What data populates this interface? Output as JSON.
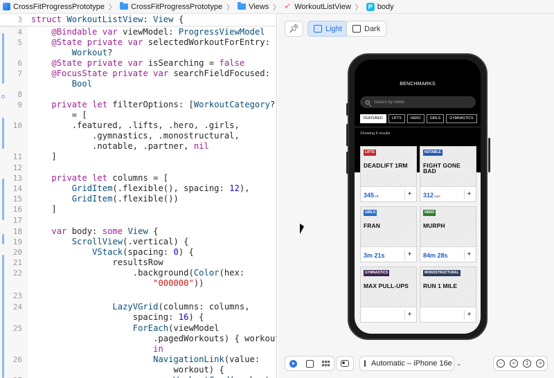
{
  "breadcrumb": [
    {
      "label": "CrossFitProgressPrototype",
      "icon": "app-icon"
    },
    {
      "label": "CrossFitProgressPrototype",
      "icon": "folder-icon"
    },
    {
      "label": "Views",
      "icon": "folder-icon"
    },
    {
      "label": "WorkoutListView",
      "icon": "swift-file-icon"
    },
    {
      "label": "body",
      "icon": "property-icon",
      "badge": "P"
    }
  ],
  "editor": {
    "lines": [
      {
        "n": "3",
        "code": "struct WorkoutListView: View {"
      },
      {
        "n": "4",
        "code": "    @Bindable var viewModel: ProgressViewModel"
      },
      {
        "n": "5",
        "code": "    @State private var selectedWorkoutForEntry:"
      },
      {
        "n": "",
        "code": "        Workout?"
      },
      {
        "n": "6",
        "code": "    @State private var isSearching = false"
      },
      {
        "n": "7",
        "code": "    @FocusState private var searchFieldFocused:"
      },
      {
        "n": "",
        "code": "        Bool"
      },
      {
        "n": "8",
        "code": ""
      },
      {
        "n": "9",
        "code": "    private let filterOptions: [WorkoutCategory?]"
      },
      {
        "n": "",
        "code": "        = ["
      },
      {
        "n": "10",
        "code": "        .featured, .lifts, .hero, .girls,"
      },
      {
        "n": "",
        "code": "            .gymnastics, .monostructural,"
      },
      {
        "n": "",
        "code": "            .notable, .partner, nil"
      },
      {
        "n": "11",
        "code": "    ]"
      },
      {
        "n": "12",
        "code": ""
      },
      {
        "n": "13",
        "code": "    private let columns = ["
      },
      {
        "n": "14",
        "code": "        GridItem(.flexible(), spacing: 12),"
      },
      {
        "n": "15",
        "code": "        GridItem(.flexible())"
      },
      {
        "n": "16",
        "code": "    ]"
      },
      {
        "n": "17",
        "code": ""
      },
      {
        "n": "18",
        "code": "    var body: some View {"
      },
      {
        "n": "19",
        "code": "        ScrollView(.vertical) {"
      },
      {
        "n": "20",
        "code": "            VStack(spacing: 0) {"
      },
      {
        "n": "21",
        "code": "                resultsRow"
      },
      {
        "n": "22",
        "code": "                    .background(Color(hex:"
      },
      {
        "n": "",
        "code": "                        \"000000\"))"
      },
      {
        "n": "23",
        "code": ""
      },
      {
        "n": "24",
        "code": "                LazyVGrid(columns: columns,"
      },
      {
        "n": "",
        "code": "                    spacing: 16) {"
      },
      {
        "n": "25",
        "code": "                    ForEach(viewModel"
      },
      {
        "n": "",
        "code": "                        .pagedWorkouts) { workout"
      },
      {
        "n": "",
        "code": "                        in"
      },
      {
        "n": "26",
        "code": "                        NavigationLink(value:"
      },
      {
        "n": "",
        "code": "                            workout) {"
      },
      {
        "n": "27",
        "code": "                            WorkoutCard(workout:"
      }
    ]
  },
  "canvas": {
    "mode_light": "Light",
    "mode_dark": "Dark",
    "device": "Automatic – iPhone 16e"
  },
  "preview": {
    "title": "BENCHMARKS",
    "search_placeholder": "Search by name",
    "filters": [
      "FEATURED",
      "LIFTS",
      "HERO",
      "GIRLS",
      "GYMNASTICS"
    ],
    "active_filter": "FEATURED",
    "results_text": "Showing 6 results",
    "cards": [
      {
        "tag": "LIFTS",
        "tag_color": "#c0282d",
        "name": "DEADLIFT 1RM",
        "value": "345",
        "unit": "LB"
      },
      {
        "tag": "NOTABLE",
        "tag_color": "#2a57b4",
        "name": "FIGHT GONE BAD",
        "value": "312",
        "unit": "reps"
      },
      {
        "tag": "GIRLS",
        "tag_color": "#2a6fc9",
        "name": "FRAN",
        "value": "3m 21s",
        "unit": ""
      },
      {
        "tag": "HERO",
        "tag_color": "#2f7d32",
        "name": "MURPH",
        "value": "84m 28s",
        "unit": ""
      },
      {
        "tag": "GYMNASTICS",
        "tag_color": "#3f2552",
        "name": "MAX PULL-UPS",
        "value": "",
        "unit": ""
      },
      {
        "tag": "MONOSTRUCTURAL",
        "tag_color": "#2d3e5c",
        "name": "RUN 1 MILE",
        "value": "",
        "unit": ""
      }
    ]
  },
  "colors": {
    "accent": "#2c6fd6",
    "keyword": "#9b2393",
    "type": "#0b4f79",
    "string": "#c41a16"
  }
}
